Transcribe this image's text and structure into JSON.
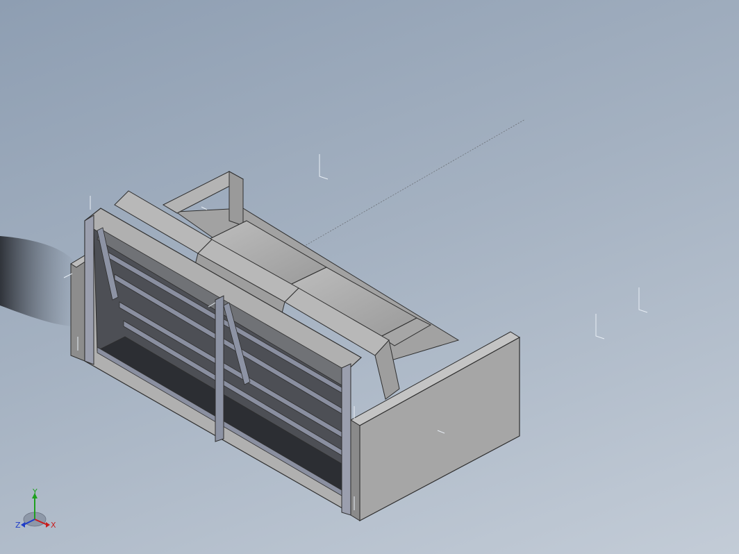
{
  "viewport": {
    "background_top": "#8e9eb2",
    "background_bottom": "#c3ccd7"
  },
  "model": {
    "subject": "sofa-frame-assembly",
    "body_color": "#a9a9a9",
    "shadow_color": "#3b3e44"
  },
  "triad": {
    "x_label": "X",
    "y_label": "Y",
    "z_label": "Z",
    "x_color": "#c81e1e",
    "y_color": "#1ea01e",
    "z_color": "#1e3cc8"
  },
  "icons": [
    "coordinate-triad-icon",
    "origin-marker-icon"
  ]
}
